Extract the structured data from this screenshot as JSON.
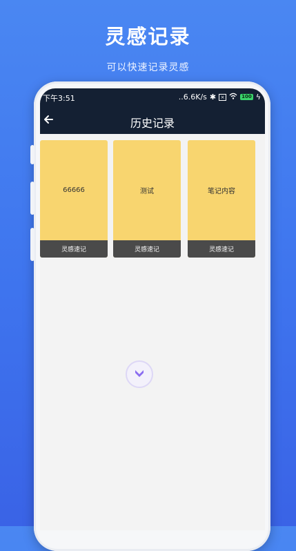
{
  "promo": {
    "title": "灵感记录",
    "subtitle": "可以快速记录灵感"
  },
  "status_bar": {
    "time": "下午3:51",
    "network_speed": "6.6K/s",
    "battery_level": "100",
    "icons": [
      "bluetooth-icon",
      "sim-icon",
      "wifi-icon",
      "battery-icon",
      "charging-icon"
    ]
  },
  "header": {
    "title": "历史记录",
    "back_icon": "back-arrow-icon"
  },
  "notes": [
    {
      "content": "66666",
      "footer": "灵感速记"
    },
    {
      "content": "测试",
      "footer": "灵感速记"
    },
    {
      "content": "笔记内容",
      "footer": "灵感速记"
    }
  ],
  "fab": {
    "icon": "chevron-down-icon"
  },
  "colors": {
    "background": "#3e74ee",
    "topbar": "#142033",
    "card": "#f8d56f",
    "card_footer": "#4a4a4a",
    "fab_accent": "#8a6cf0"
  }
}
